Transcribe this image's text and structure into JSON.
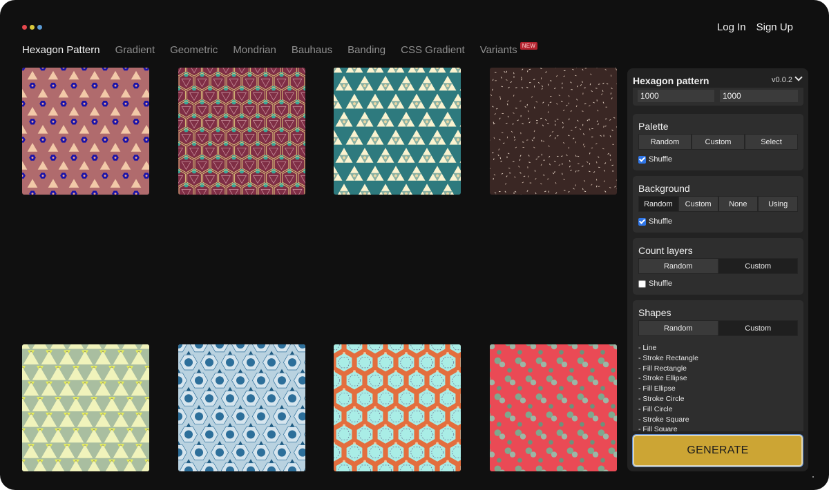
{
  "window": {
    "dots": [
      {
        "name": "red-dot",
        "color": "#e5484d"
      },
      {
        "name": "yellow-dot",
        "color": "#d9c93b"
      },
      {
        "name": "blue-dot",
        "color": "#5b9bd5"
      }
    ]
  },
  "auth": {
    "login": "Log In",
    "signup": "Sign Up"
  },
  "nav": {
    "tabs": [
      "Hexagon Pattern",
      "Gradient",
      "Geometric",
      "Mondrian",
      "Bauhaus",
      "Banding",
      "CSS Gradient",
      "Variants"
    ],
    "active": "Hexagon Pattern",
    "badge": "NEW"
  },
  "gallery": {
    "thumbnails": [
      {
        "bg": "#b06b6d",
        "c1": "#1a14a8",
        "c2": "#f2c9a8",
        "c3": "#f0a28a"
      },
      {
        "bg": "#7f2e45",
        "c1": "#3aa89a",
        "c2": "#d9c17a",
        "c3": "#c88f9b"
      },
      {
        "bg": "#2e7a7e",
        "c1": "#fbf3d0",
        "c2": "#e9d7a4",
        "c3": "#ffffff"
      },
      {
        "bg": "#3a2724",
        "c1": "#e8d7c8",
        "c2": "#c9b2a3",
        "c3": "#ffffff"
      },
      {
        "bg": "#a9bea0",
        "c1": "#f0f3bb",
        "c2": "#e9f05a",
        "c3": "#2f2f2f"
      },
      {
        "bg": "#b9d2e0",
        "c1": "#2d6f9a",
        "c2": "#d6e5ee",
        "c3": "#1f5a80"
      },
      {
        "bg": "#e36e3e",
        "c1": "#a9ede6",
        "c2": "#5a4b7a",
        "c3": "#f3c39a"
      },
      {
        "bg": "#ea4a55",
        "c1": "#7fa88e",
        "c2": "#9cb6a6",
        "c3": "#6c927c"
      }
    ]
  },
  "panel": {
    "title": "Hexagon pattern",
    "version": "v0.0.2",
    "width": "1000",
    "height": "1000",
    "palette": {
      "title": "Palette",
      "options": [
        "Random",
        "Custom",
        "Select"
      ],
      "selected": "Random",
      "shuffle_label": "Shuffle",
      "shuffle": true
    },
    "background": {
      "title": "Background",
      "options": [
        "Random",
        "Custom",
        "None",
        "Using"
      ],
      "selected": "Random",
      "shuffle_label": "Shuffle",
      "shuffle": true
    },
    "count_layers": {
      "title": "Count layers",
      "options": [
        "Random",
        "Custom"
      ],
      "selected": "Custom",
      "shuffle_label": "Shuffle",
      "shuffle": false
    },
    "shapes": {
      "title": "Shapes",
      "options": [
        "Random",
        "Custom"
      ],
      "selected": "Custom",
      "items": [
        "- Line",
        "- Stroke Rectangle",
        "- Fill Rectangle",
        "- Stroke Ellipse",
        "- Fill Ellipse",
        "- Stroke Circle",
        "- Fill Circle",
        "- Stroke Square",
        "- Fill Square"
      ]
    },
    "generate": "GENERATE"
  }
}
